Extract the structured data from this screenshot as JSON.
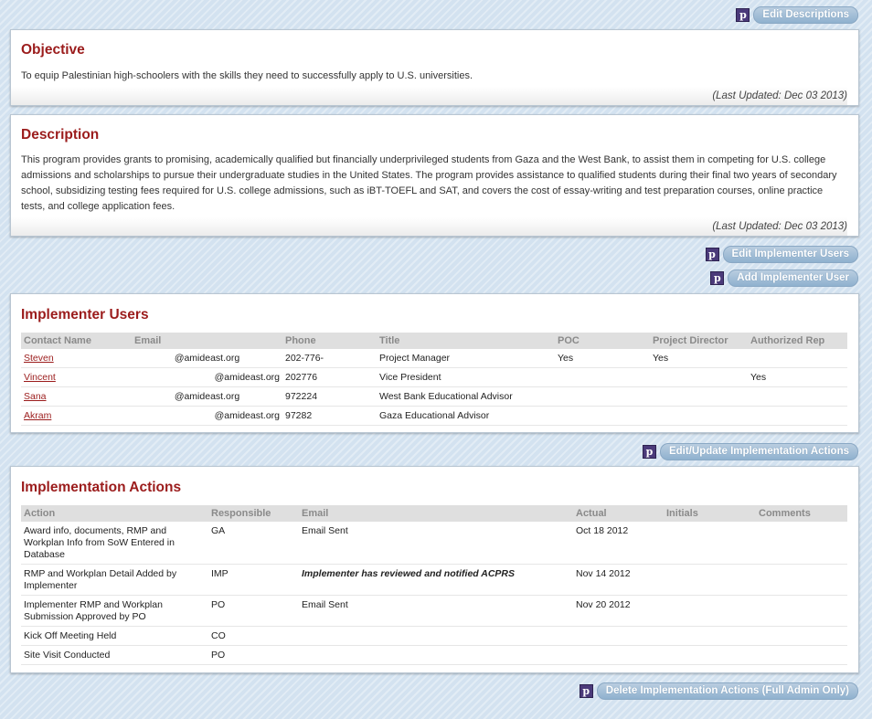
{
  "buttons": {
    "edit_descriptions": "Edit Descriptions",
    "edit_implementer_users": "Edit Implementer Users",
    "add_implementer_user": "Add Implementer User",
    "edit_update_actions": "Edit/Update Implementation Actions",
    "delete_actions": "Delete Implementation Actions (Full Admin Only)",
    "p_icon_glyph": "p"
  },
  "objective": {
    "title": "Objective",
    "text": "To equip Palestinian high-schoolers with the skills they need to successfully apply to U.S. universities.",
    "updated": "(Last Updated: Dec 03 2013)"
  },
  "description": {
    "title": "Description",
    "text": "This program provides grants to promising, academically qualified but financially underprivileged students from Gaza and the West Bank, to assist them in competing for U.S. college admissions and scholarships to pursue their undergraduate studies in the United States. The program provides assistance to qualified students during their final two years of secondary school, subsidizing testing fees required for U.S. college admissions, such as iBT-TOEFL and SAT, and covers the cost of essay-writing and test preparation courses, online practice tests, and college application fees.",
    "updated": "(Last Updated: Dec 03 2013)"
  },
  "implementer_users": {
    "title": "Implementer Users",
    "headers": [
      "Contact Name",
      "Email",
      "Phone",
      "Title",
      "POC",
      "Project Director",
      "Authorized Rep"
    ],
    "rows": [
      {
        "name": "Steven",
        "email": "@amideast.org",
        "phone": "202-776-",
        "title": "Project Manager",
        "poc": "Yes",
        "director": "Yes",
        "rep": ""
      },
      {
        "name": "Vincent",
        "email": "@amideast.org",
        "phone": "202776",
        "title": "Vice President",
        "poc": "",
        "director": "",
        "rep": "Yes"
      },
      {
        "name": "Sana",
        "email": "@amideast.org",
        "phone": "972224",
        "title": "West Bank Educational Advisor",
        "poc": "",
        "director": "",
        "rep": ""
      },
      {
        "name": "Akram",
        "email": "@amideast.org",
        "phone": "97282",
        "title": "Gaza Educational Advisor",
        "poc": "",
        "director": "",
        "rep": ""
      }
    ]
  },
  "implementation_actions": {
    "title": "Implementation Actions",
    "headers": [
      "Action",
      "Responsible",
      "Email",
      "Actual",
      "Initials",
      "Comments"
    ],
    "rows": [
      {
        "action": "Award info, documents, RMP and Workplan Info from SoW Entered in Database",
        "responsible": "GA",
        "email": "Email Sent",
        "actual": "Oct 18 2012",
        "initials": "",
        "comments": ""
      },
      {
        "action": "RMP and Workplan Detail Added by Implementer",
        "responsible": "IMP",
        "email": "Implementer has reviewed and notified ACPRS",
        "actual": "Nov 14 2012",
        "initials": "",
        "comments": ""
      },
      {
        "action": "Implementer RMP and Workplan Submission Approved by PO",
        "responsible": "PO",
        "email": "Email Sent",
        "actual": "Nov 20 2012",
        "initials": "",
        "comments": ""
      },
      {
        "action": "Kick Off Meeting Held",
        "responsible": "CO",
        "email": "",
        "actual": "",
        "initials": "",
        "comments": ""
      },
      {
        "action": "Site Visit Conducted",
        "responsible": "PO",
        "email": "",
        "actual": "",
        "initials": "",
        "comments": ""
      }
    ]
  }
}
